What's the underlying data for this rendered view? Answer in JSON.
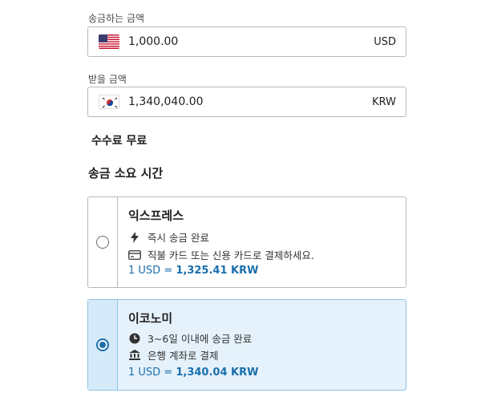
{
  "send": {
    "label": "송금하는 금액",
    "amount": "1,000.00",
    "currency": "USD",
    "flag_icon": "us-flag-icon"
  },
  "receive": {
    "label": "받을 금액",
    "amount": "1,340,040.00",
    "currency": "KRW",
    "flag_icon": "kr-flag-icon"
  },
  "fee_text": "수수료 무료",
  "delivery_title": "송금 소요 시간",
  "options": [
    {
      "title": "익스프레스",
      "selected": false,
      "line1": {
        "icon": "lightning-icon",
        "text": "즉시 송금 완료"
      },
      "line2": {
        "icon": "card-icon",
        "text": "직불 카드 또는 신용 카드로 결제하세요."
      },
      "rate_prefix": "1 USD = ",
      "rate_value": "1,325.41 KRW"
    },
    {
      "title": "이코노미",
      "selected": true,
      "line1": {
        "icon": "clock-icon",
        "text": "3~6일 이내에 송금 완료"
      },
      "line2": {
        "icon": "bank-icon",
        "text": "은행 계좌로 결제"
      },
      "rate_prefix": "1 USD = ",
      "rate_value": "1,340.04 KRW"
    }
  ],
  "colors": {
    "accent": "#1b6fad",
    "selected_bg": "#e5f2fc",
    "border": "#b9b9b9"
  }
}
